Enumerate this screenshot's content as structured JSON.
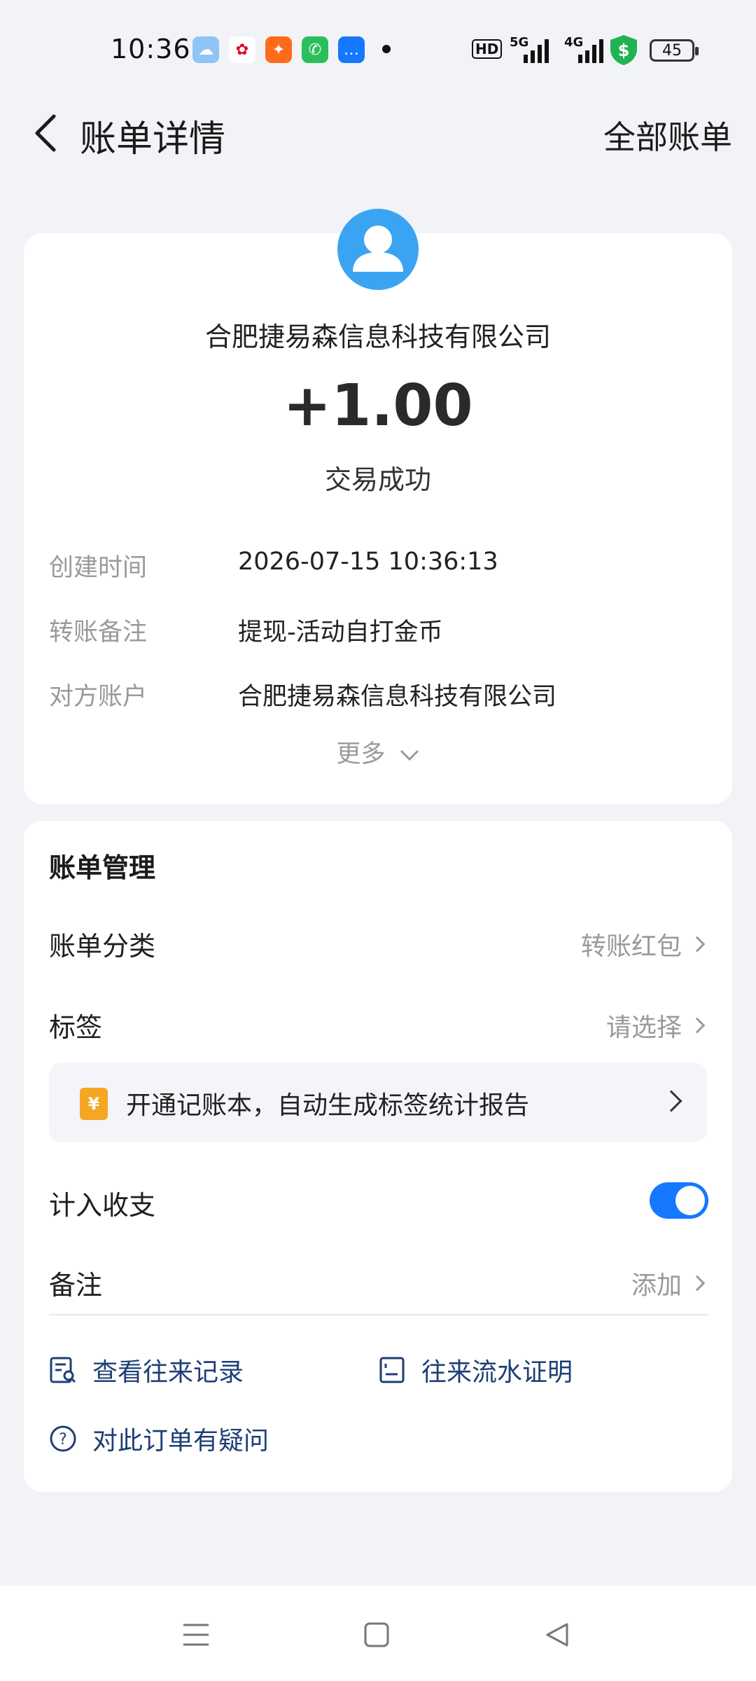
{
  "status_bar": {
    "time": "10:36",
    "network_label": "HD",
    "signal_5g": "5G",
    "signal_4g": "4G",
    "battery": "45"
  },
  "header": {
    "title": "账单详情",
    "all_bills": "全部账单"
  },
  "transaction": {
    "counterparty": "合肥捷易森信息科技有限公司",
    "amount": "+1.00",
    "status": "交易成功",
    "details": [
      {
        "label": "创建时间",
        "value": "2026-07-15 10:36:13"
      },
      {
        "label": "转账备注",
        "value": "提现-活动自打金币"
      },
      {
        "label": "对方账户",
        "value": "合肥捷易森信息科技有限公司"
      }
    ],
    "more": "更多"
  },
  "management": {
    "title": "账单管理",
    "category_label": "账单分类",
    "category_value": "转账红包",
    "tag_label": "标签",
    "tag_value": "请选择",
    "promo_text": "开通记账本，自动生成标签统计报告",
    "promo_icon": "¥",
    "count_label": "计入收支",
    "count_enabled": true,
    "note_label": "备注",
    "note_value": "添加",
    "links": {
      "history": "查看往来记录",
      "statement": "往来流水证明",
      "question": "对此订单有疑问"
    }
  }
}
